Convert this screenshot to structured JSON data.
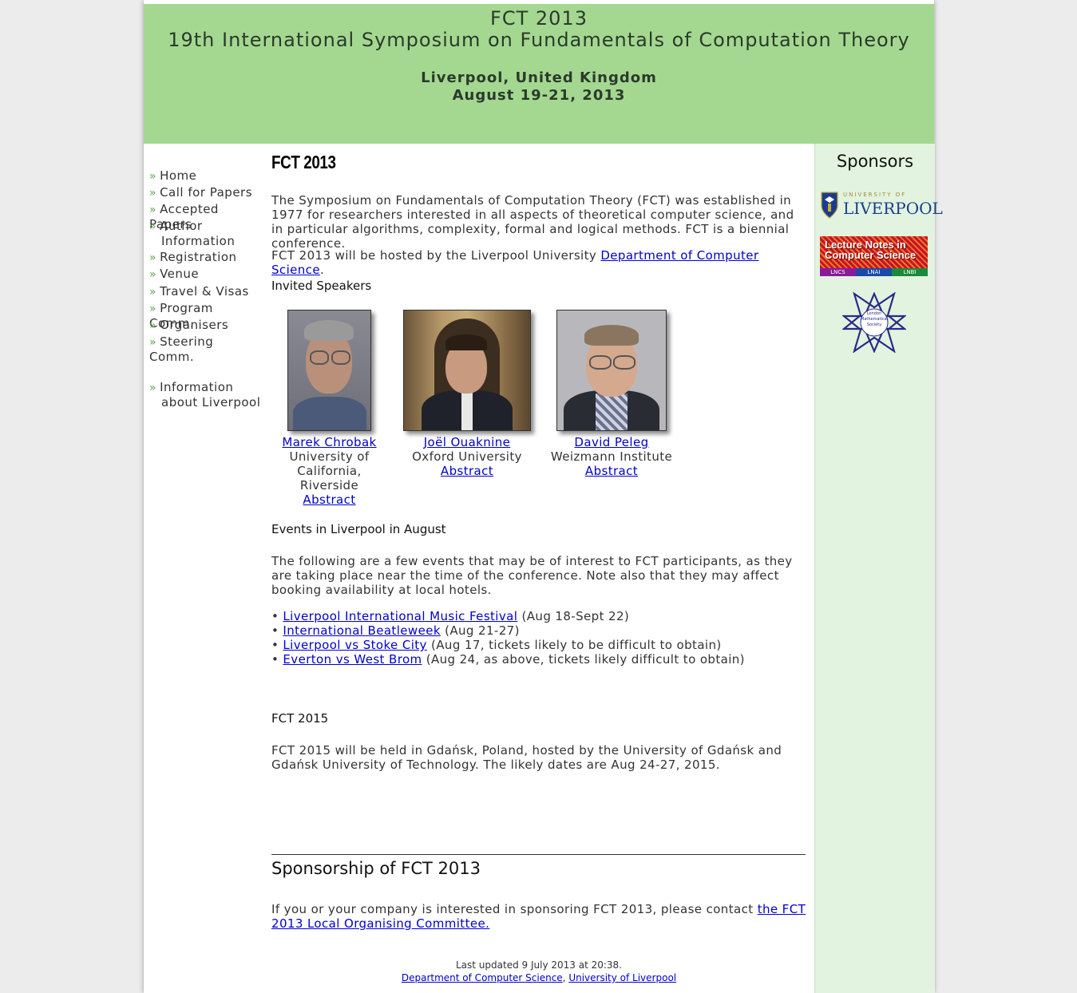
{
  "header": {
    "line1": "FCT 2013",
    "line2": "19th International Symposium on Fundamentals of Computation Theory",
    "line3": "Liverpool, United Kingdom",
    "line4": "August 19-21, 2013"
  },
  "nav": {
    "arrow": "»",
    "items": [
      {
        "label": "Home"
      },
      {
        "label": "Call for Papers"
      },
      {
        "label": "Accepted Papers"
      },
      {
        "label": "Author",
        "cont": "Information"
      },
      {
        "label": "Registration"
      },
      {
        "label": "Venue"
      },
      {
        "label": "Travel & Visas"
      },
      {
        "label": "Program Comm."
      },
      {
        "label": "Organisers"
      },
      {
        "label": "Steering Comm."
      },
      {
        "label": "Information",
        "cont": "about Liverpool"
      }
    ]
  },
  "main": {
    "title": "FCT 2013",
    "intro": "The Symposium on Fundamentals of Computation Theory (FCT) was established in 1977 for researchers interested in all aspects of theoretical computer science, and in particular algorithms, complexity, formal and logical methods. FCT is a biennial conference.",
    "hosted_prefix": "FCT 2013 will be hosted by the Liverpool University ",
    "hosted_link": "Department of Computer Science",
    "hosted_suffix": ".",
    "invited_heading": "Invited Speakers",
    "speakers": [
      {
        "name": "Marek Chrobak",
        "affil1": "University of",
        "affil2": "California, Riverside",
        "abstract": "Abstract"
      },
      {
        "name": "Joël Ouaknine",
        "affil1": "Oxford University",
        "abstract": "Abstract"
      },
      {
        "name": "David Peleg",
        "affil1": "Weizmann Institute",
        "abstract": "Abstract"
      }
    ],
    "events_heading": "Events in Liverpool in August",
    "events_intro": "The following are a few events that may be of interest to FCT participants, as they are taking place near the time of the conference. Note also that they may affect booking availability at local hotels.",
    "bullet": "•",
    "events": [
      {
        "link": "Liverpool International Music Festival",
        "note": " (Aug 18-Sept 22)"
      },
      {
        "link": "International Beatleweek",
        "note": " (Aug 21-27)"
      },
      {
        "link": "Liverpool vs Stoke City",
        "note": " (Aug 17, tickets likely to be difficult to obtain)"
      },
      {
        "link": "Everton vs West Brom",
        "note": " (Aug 24, as above, tickets likely difficult to obtain)"
      }
    ],
    "fct2015_heading": "FCT 2015",
    "fct2015_text": "FCT 2015 will be held in Gdańsk, Poland, hosted by the University of Gdańsk and Gdańsk University of Technology. The likely dates are Aug 24-27, 2015.",
    "sponsorship_heading": "Sponsorship of FCT 2013",
    "sponsorship_prefix": "If you or your company is interested in sponsoring FCT 2013, please contact ",
    "sponsorship_link": "the FCT 2013 Local Organising Committee.",
    "footer_updated": "Last updated 9 July 2013 at 20:38.",
    "footer_link1": "Department of Computer Science",
    "footer_sep": ", ",
    "footer_link2": "University of Liverpool"
  },
  "sidebar": {
    "title": "Sponsors",
    "logo1_small": "UNIVERSITY OF",
    "logo1_big": "LIVERPOOL",
    "logo2_line1": "Lecture Notes in",
    "logo2_line2": "Computer Science",
    "logo2_tags": [
      "LNCS",
      "LNAI",
      "LNBI"
    ],
    "logo3_text": [
      "London",
      "Mathematical",
      "Society"
    ]
  },
  "colors": {
    "header_bg": "#a4d891",
    "sidebar_bg": "#e2f3df",
    "link": "#0000cc",
    "arrow": "#5ca84a"
  }
}
